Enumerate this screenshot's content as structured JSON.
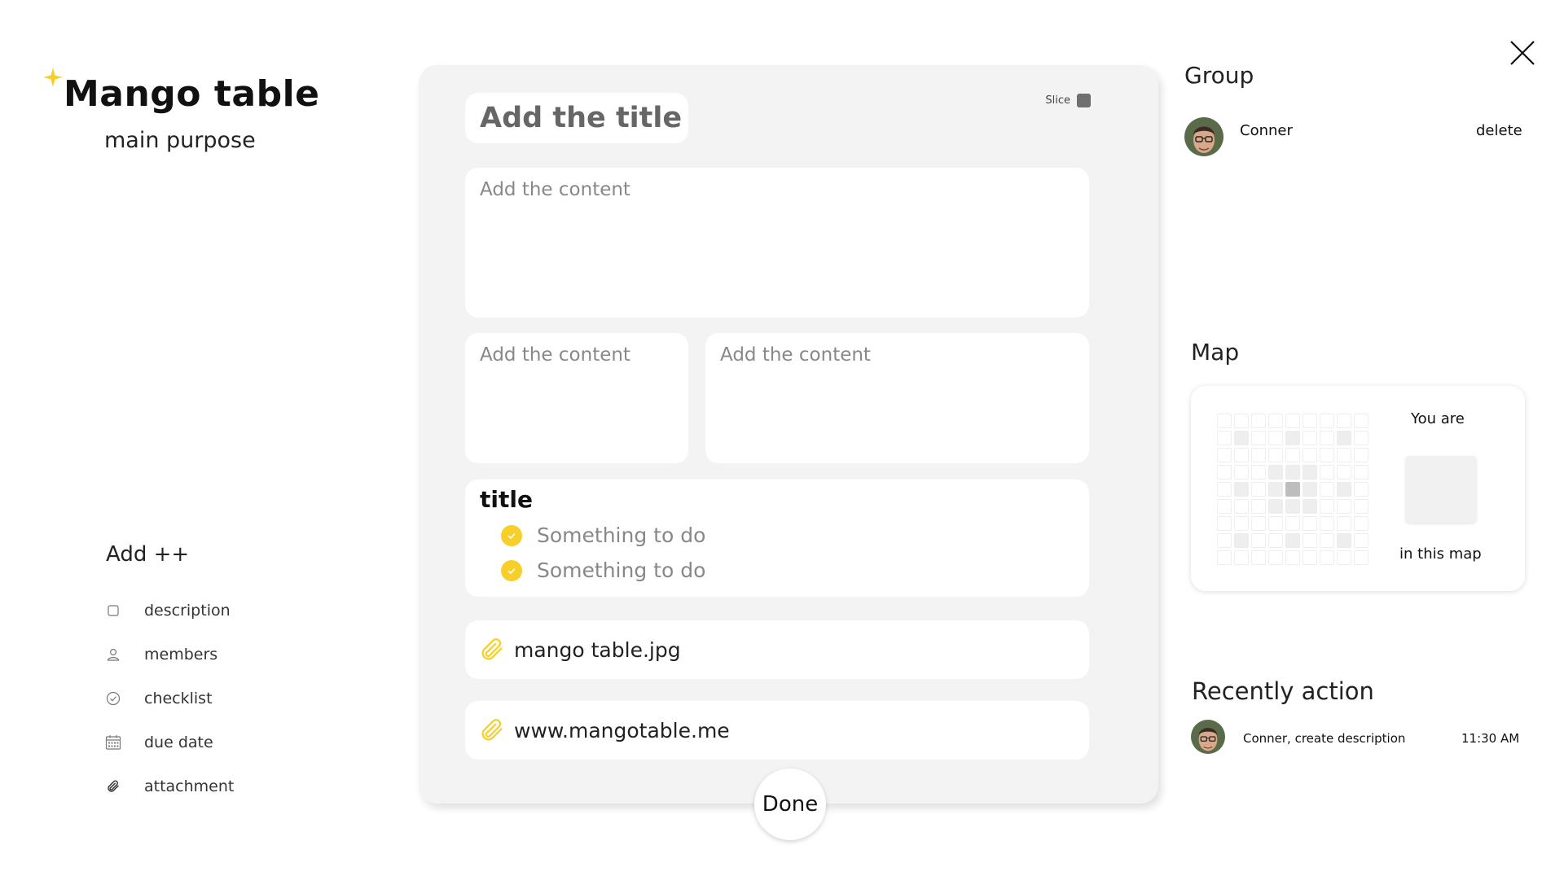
{
  "brand": {
    "title": "Mango table",
    "subtitle": "main purpose",
    "accent": "#f7cf2a"
  },
  "add_menu": {
    "heading": "Add ++",
    "items": [
      {
        "label": "description",
        "icon": "square-icon"
      },
      {
        "label": "members",
        "icon": "user-icon"
      },
      {
        "label": "checklist",
        "icon": "check-circle-icon"
      },
      {
        "label": "due date",
        "icon": "calendar-icon"
      },
      {
        "label": "attachment",
        "icon": "paperclip-icon"
      }
    ]
  },
  "card": {
    "title_placeholder": "Add the title",
    "slice_label": "Slice",
    "content_placeholders": [
      "Add the content",
      "Add the content",
      "Add the content"
    ],
    "checklist": {
      "title": "title",
      "items": [
        "Something to do",
        "Something to do"
      ]
    },
    "attachments": [
      "mango table.jpg",
      "www.mangotable.me"
    ],
    "done_label": "Done"
  },
  "group": {
    "heading": "Group",
    "members": [
      {
        "name": "Conner",
        "action_label": "delete"
      }
    ]
  },
  "map": {
    "heading": "Map",
    "you_are": "You are",
    "in_this_map": "in this map"
  },
  "recent": {
    "heading": "Recently action",
    "items": [
      {
        "text": "Conner, create description",
        "time": "11:30 AM"
      }
    ]
  }
}
